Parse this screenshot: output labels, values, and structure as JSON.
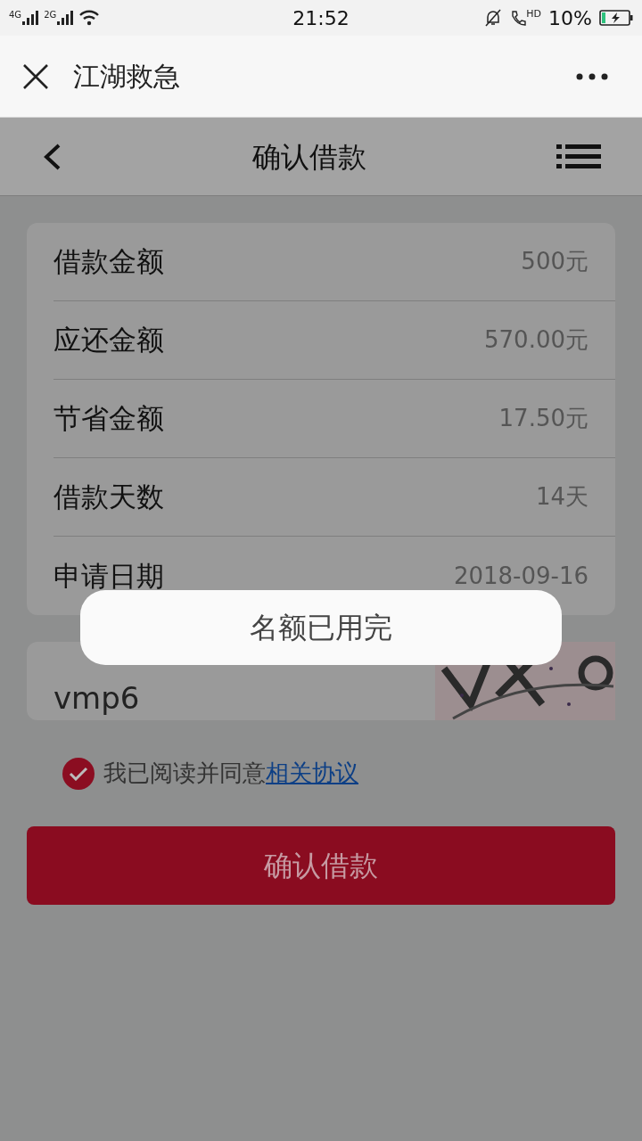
{
  "status_bar": {
    "network_1": "4G",
    "network_2": "2G",
    "time": "21:52",
    "call_badge": "HD",
    "battery": "10%"
  },
  "browser_bar": {
    "title": "江湖救急"
  },
  "header": {
    "title": "确认借款"
  },
  "details": [
    {
      "label": "借款金额",
      "value": "500元"
    },
    {
      "label": "应还金额",
      "value": "570.00元"
    },
    {
      "label": "节省金额",
      "value": "17.50元"
    },
    {
      "label": "借款天数",
      "value": "14天"
    },
    {
      "label": "申请日期",
      "value": "2018-09-16"
    }
  ],
  "captcha": {
    "value": "vmp6"
  },
  "agreement": {
    "checked": true,
    "text": "我已阅读并同意",
    "link": "相关协议"
  },
  "confirm_button": {
    "label": "确认借款"
  },
  "toast": {
    "message": "名额已用完"
  }
}
